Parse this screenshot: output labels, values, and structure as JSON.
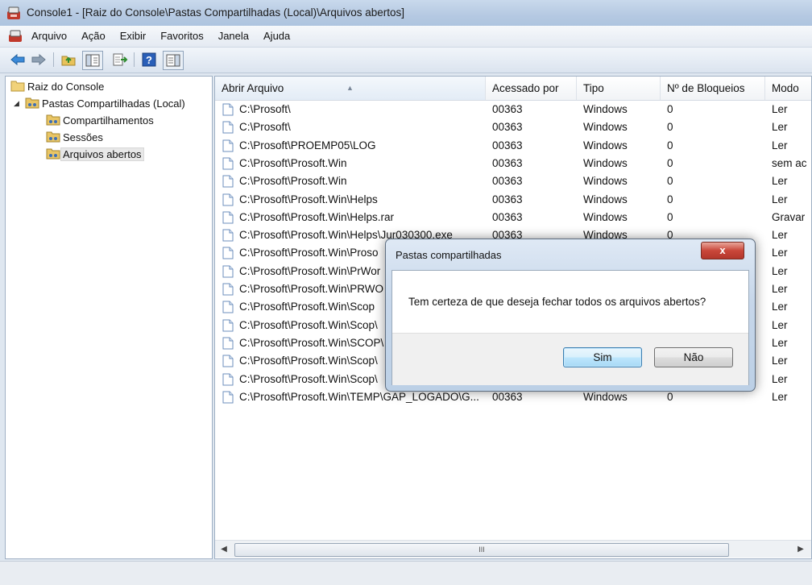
{
  "window": {
    "title": "Console1 - [Raiz do Console\\Pastas Compartilhadas (Local)\\Arquivos abertos]"
  },
  "menu": [
    "Arquivo",
    "Ação",
    "Exibir",
    "Favoritos",
    "Janela",
    "Ajuda"
  ],
  "toolbar": {
    "buttons": [
      "back-icon",
      "forward-icon",
      "up-folder-icon",
      "show-hide-tree-icon",
      "export-list-icon",
      "help-icon",
      "show-hide-action-pane-icon"
    ]
  },
  "tree": {
    "root": "Raiz do Console",
    "group": "Pastas Compartilhadas (Local)",
    "children": [
      "Compartilhamentos",
      "Sessões",
      "Arquivos abertos"
    ],
    "selected": "Arquivos abertos"
  },
  "list": {
    "columns": [
      "Abrir Arquivo",
      "Acessado por",
      "Tipo",
      "Nº de Bloqueios",
      "Modo"
    ],
    "rows": [
      {
        "file": "C:\\Prosoft\\",
        "user": "00363",
        "type": "Windows",
        "locks": "0",
        "mode": "Ler"
      },
      {
        "file": "C:\\Prosoft\\",
        "user": "00363",
        "type": "Windows",
        "locks": "0",
        "mode": "Ler"
      },
      {
        "file": "C:\\Prosoft\\PROEMP05\\LOG",
        "user": "00363",
        "type": "Windows",
        "locks": "0",
        "mode": "Ler"
      },
      {
        "file": "C:\\Prosoft\\Prosoft.Win",
        "user": "00363",
        "type": "Windows",
        "locks": "0",
        "mode": "sem ac"
      },
      {
        "file": "C:\\Prosoft\\Prosoft.Win",
        "user": "00363",
        "type": "Windows",
        "locks": "0",
        "mode": "Ler"
      },
      {
        "file": "C:\\Prosoft\\Prosoft.Win\\Helps",
        "user": "00363",
        "type": "Windows",
        "locks": "0",
        "mode": "Ler"
      },
      {
        "file": "C:\\Prosoft\\Prosoft.Win\\Helps.rar",
        "user": "00363",
        "type": "Windows",
        "locks": "0",
        "mode": "Gravar"
      },
      {
        "file": "C:\\Prosoft\\Prosoft.Win\\Helps\\Jur030300.exe",
        "user": "00363",
        "type": "Windows",
        "locks": "0",
        "mode": "Ler"
      },
      {
        "file": "C:\\Prosoft\\Prosoft.Win\\Proso",
        "user": "",
        "type": "",
        "locks": "",
        "mode": "Ler"
      },
      {
        "file": "C:\\Prosoft\\Prosoft.Win\\PrWor",
        "user": "",
        "type": "",
        "locks": "",
        "mode": "Ler"
      },
      {
        "file": "C:\\Prosoft\\Prosoft.Win\\PRWO",
        "user": "",
        "type": "",
        "locks": "",
        "mode": "Ler"
      },
      {
        "file": "C:\\Prosoft\\Prosoft.Win\\Scop",
        "user": "",
        "type": "",
        "locks": "",
        "mode": "Ler"
      },
      {
        "file": "C:\\Prosoft\\Prosoft.Win\\Scop\\",
        "user": "",
        "type": "",
        "locks": "",
        "mode": "Ler"
      },
      {
        "file": "C:\\Prosoft\\Prosoft.Win\\SCOP\\",
        "user": "",
        "type": "",
        "locks": "",
        "mode": "Ler"
      },
      {
        "file": "C:\\Prosoft\\Prosoft.Win\\Scop\\",
        "user": "",
        "type": "",
        "locks": "",
        "mode": "Ler"
      },
      {
        "file": "C:\\Prosoft\\Prosoft.Win\\Scop\\",
        "user": "",
        "type": "",
        "locks": "",
        "mode": "Ler"
      },
      {
        "file": "C:\\Prosoft\\Prosoft.Win\\TEMP\\GAP_LOGADO\\G...",
        "user": "00363",
        "type": "Windows",
        "locks": "0",
        "mode": "Ler"
      }
    ],
    "scroll_thumb_glyph": "III"
  },
  "dialog": {
    "title": "Pastas compartilhadas",
    "close_label": "x",
    "message": "Tem certeza de que deseja fechar todos os arquivos abertos?",
    "yes": "Sim",
    "no": "Não"
  }
}
